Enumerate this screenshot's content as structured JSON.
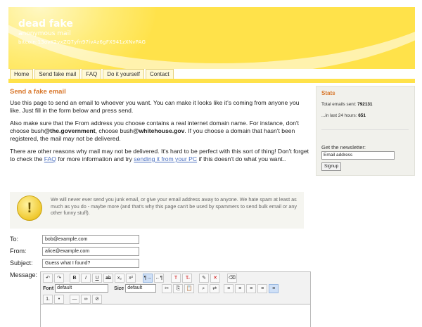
{
  "header": {
    "title": "dead fake",
    "subtitle": "anonymous mail",
    "bitcoin": "bitcoin:13ovK2vxZQ7yfn97ivAz6gFX941zXNvPAG"
  },
  "nav": {
    "tabs": [
      "Home",
      "Send fake mail",
      "FAQ",
      "Do it yourself",
      "Contact"
    ]
  },
  "main": {
    "heading": "Send a fake email",
    "p1": "Use this page to send an email to whoever you want. You can make it looks like it's coming from anyone you like. Just fill in the form below and press send.",
    "p2_a": "Also make sure that the From address you choose contains a real internet domain name. For instance, don't choose bush",
    "p2_b": "@the.government",
    "p2_c": ", choose bush",
    "p2_d": "@whitehouse.gov",
    "p2_e": ". If you choose a domain that hasn't been registered, the mail may not be delivered.",
    "p3_a": "There are other reasons why mail may not be delivered. It's hard to be perfect with this sort of thing! Don't forget to check the ",
    "p3_faq": "FAQ",
    "p3_b": " for more information and try ",
    "p3_link": "sending it from your PC",
    "p3_c": " if this doesn't do what you want.."
  },
  "warning": {
    "text": "We will never ever send you junk email, or give your email address away to anyone. We hate spam at least as much as you do - maybe more (and that's why this page can't be used by spammers to send bulk email or any other funny stuff)."
  },
  "form": {
    "to_label": "To:",
    "to_value": "bob@example.com",
    "from_label": "From:",
    "from_value": "alice@example.com",
    "subject_label": "Subject:",
    "subject_value": "Guess what I found?",
    "message_label": "Message:"
  },
  "editor": {
    "font_label": "Font",
    "font_value": "default",
    "size_label": "Size",
    "size_value": "default"
  },
  "sidebar": {
    "heading": "Stats",
    "total_label": "Total emails sent:",
    "total_value": "792131",
    "last24_label": "...in last 24 hours:",
    "last24_value": "651",
    "newsletter_label": "Get the newsletter:",
    "email_placeholder": "Email address",
    "signup_label": "Signup"
  },
  "colors": {
    "accent": "#ffe24a",
    "heading": "#d8762a",
    "link": "#4a6fbf"
  }
}
